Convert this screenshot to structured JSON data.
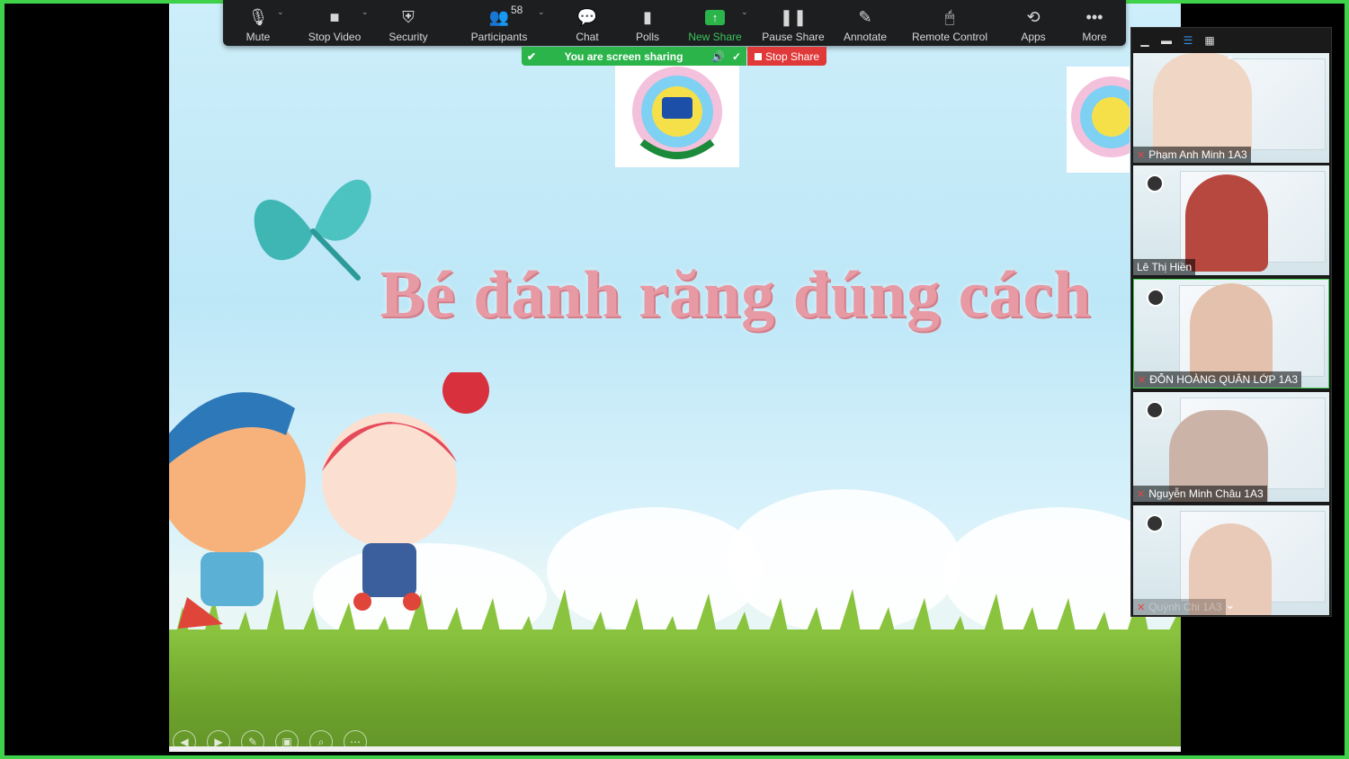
{
  "toolbar": {
    "mute": "Mute",
    "stop_video": "Stop Video",
    "security": "Security",
    "participants": "Participants",
    "participants_count": "58",
    "chat": "Chat",
    "polls": "Polls",
    "new_share": "New Share",
    "pause_share": "Pause Share",
    "annotate": "Annotate",
    "remote_control": "Remote Control",
    "apps": "Apps",
    "more": "More"
  },
  "share_banner": {
    "text": "You are screen sharing",
    "stop_label": "Stop Share"
  },
  "slide": {
    "title": "Bé đánh răng đúng cách"
  },
  "participants": [
    {
      "name": "Phạm Anh Minh 1A3",
      "muted": true
    },
    {
      "name": "Lê Thị Hiền",
      "muted": false
    },
    {
      "name": "ĐỖN HOÀNG QUÂN LỚP 1A3",
      "muted": true
    },
    {
      "name": "Nguyễn Minh Châu 1A3",
      "muted": true
    },
    {
      "name": "Quỳnh Chi 1A3",
      "muted": true
    }
  ],
  "colors": {
    "frame_green": "#3fd14a",
    "share_green": "#2ab449",
    "stop_red": "#e0393a",
    "toolbar_bg": "#1d1e20"
  }
}
